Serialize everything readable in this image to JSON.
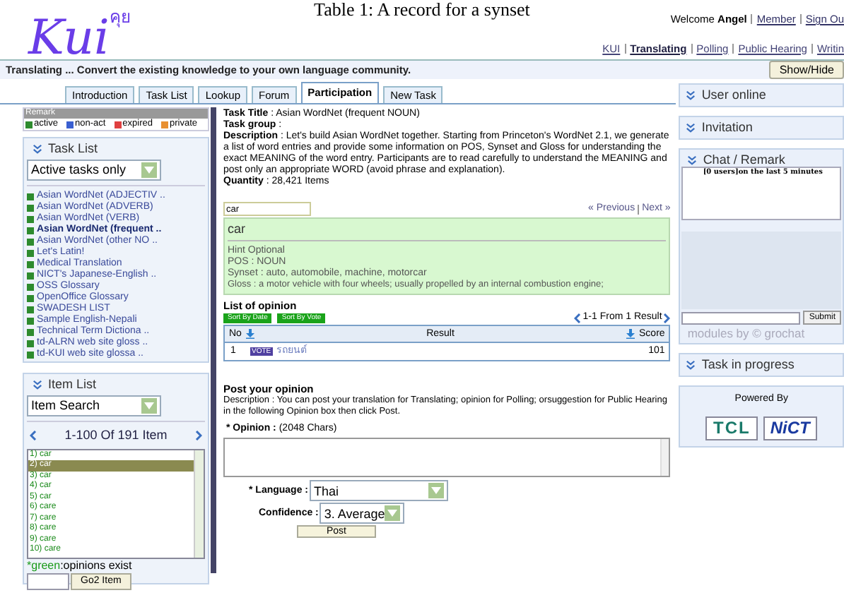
{
  "caption": "Table 1: A record for a synset",
  "header": {
    "logo": "Kui",
    "logo_thai": "คุย",
    "welcome": "Welcome",
    "user": "Angel",
    "account_links": [
      "Member",
      "Sign Ou"
    ],
    "nav": [
      {
        "label": "KUI",
        "selected": false
      },
      {
        "label": "Translating",
        "selected": true
      },
      {
        "label": "Polling",
        "selected": false
      },
      {
        "label": "Public Hearing",
        "selected": false
      },
      {
        "label": "Writin",
        "selected": false
      }
    ]
  },
  "tagline": "Translating ... Convert the existing knowledge to your own language community.",
  "show_hide": "Show/Hide",
  "tabs": [
    {
      "label": "Introduction",
      "selected": false
    },
    {
      "label": "Task List",
      "selected": false
    },
    {
      "label": "Lookup",
      "selected": false
    },
    {
      "label": "Forum",
      "selected": false
    },
    {
      "label": "Participation",
      "selected": true
    },
    {
      "label": "New Task",
      "selected": false
    }
  ],
  "legend": {
    "title": "Remark",
    "items": [
      {
        "label": "active",
        "color": "#2e8b2e"
      },
      {
        "label": "non-act",
        "color": "#3a5fd0"
      },
      {
        "label": "expired",
        "color": "#e04040"
      },
      {
        "label": "private",
        "color": "#e89030"
      }
    ]
  },
  "task_list": {
    "title": "Task List",
    "filter": "Active tasks only",
    "items": [
      {
        "label": "Asian WordNet (ADJECTIV ..",
        "selected": false
      },
      {
        "label": "Asian WordNet (ADVERB)",
        "selected": false
      },
      {
        "label": "Asian WordNet (VERB)",
        "selected": false
      },
      {
        "label": "Asian WordNet (frequent ..",
        "selected": true
      },
      {
        "label": "Asian WordNet (other NO ..",
        "selected": false
      },
      {
        "label": "Let's Latin!",
        "selected": false
      },
      {
        "label": "Medical Translation",
        "selected": false
      },
      {
        "label": "NICT's Japanese-English ..",
        "selected": false
      },
      {
        "label": "OSS Glossary",
        "selected": false
      },
      {
        "label": "OpenOffice Glossary",
        "selected": false
      },
      {
        "label": "SWADESH LIST",
        "selected": false
      },
      {
        "label": "Sample English-Nepali",
        "selected": false
      },
      {
        "label": "Technical Term Dictiona ..",
        "selected": false
      },
      {
        "label": "td-ALRN web site gloss ..",
        "selected": false
      },
      {
        "label": "td-KUI web site glossa ..",
        "selected": false
      }
    ]
  },
  "item_list": {
    "title": "Item List",
    "search": "Item Search",
    "pager": "1-100 Of 191 Item",
    "items": [
      {
        "label": "1) car",
        "selected": false
      },
      {
        "label": "2) car",
        "selected": true
      },
      {
        "label": "3) car",
        "selected": false
      },
      {
        "label": "4) car",
        "selected": false
      },
      {
        "label": "5) car",
        "selected": false
      },
      {
        "label": "6) care",
        "selected": false
      },
      {
        "label": "7) care",
        "selected": false
      },
      {
        "label": "8) care",
        "selected": false
      },
      {
        "label": "9) care",
        "selected": false
      },
      {
        "label": "10) care",
        "selected": false
      }
    ],
    "note_marker": "*green",
    "note_text": ":opinions exist",
    "go_button": "Go2 Item"
  },
  "task": {
    "title": "**Task Title** : Asian WordNet (frequent NOUN)",
    "group": "**Task group** :",
    "description": "**Description** : Let's build Asian WordNet together. Starting from Princeton's WordNet 2.1, we generate a list of word entries and provide some information on POS, Synset and Gloss for understanding the exact MEANING of the word entry. Participants are to read carefully to understand the MEANING and post only an appropriate WORD (avoid phrase and explanation).",
    "quantity": "**Quantity** : 28,421 Items"
  },
  "word_search": "car",
  "previous": "« Previous",
  "next": "Next »",
  "entry": {
    "word": "car",
    "hint": "Hint Optional",
    "pos": "POS : NOUN",
    "synset": "Synset : auto, automobile, machine, motorcar",
    "gloss": "Gloss : a motor vehicle with four wheels; usually propelled by an internal combustion engine;"
  },
  "opinions": {
    "title": "List of opinion",
    "sort_buttons": [
      "Sort By Date",
      "Sort By Vote"
    ],
    "pager": "1-1 From 1 Result",
    "columns": [
      "No",
      "Result",
      "Score"
    ],
    "rows": [
      {
        "no": "1",
        "badge": "VOTE",
        "result": "รถยนต์",
        "score": "101"
      }
    ]
  },
  "post": {
    "title": "Post your opinion",
    "description": "Description : You can post your translation for Translating; opinion for Polling; orsuggestion for Public Hearing in the following Opinion box then click Post.",
    "opinion_label": "* Opinion :",
    "opinion_limit": "(2048 Chars)",
    "language_label": "* Language :",
    "language": "Thai",
    "confidence_label": "Confidence :",
    "confidence": "3. Average",
    "button": "Post"
  },
  "right": {
    "user_online": "User online",
    "invitation": "Invitation",
    "chat_title": "Chat / Remark",
    "chat_status": "[0 users]on the last 5 minutes",
    "submit": "Submit",
    "credit": "modules by © grochat",
    "task_progress": "Task in progress",
    "powered_by": "Powered By",
    "logos": [
      "TCL",
      "NiCT"
    ]
  }
}
